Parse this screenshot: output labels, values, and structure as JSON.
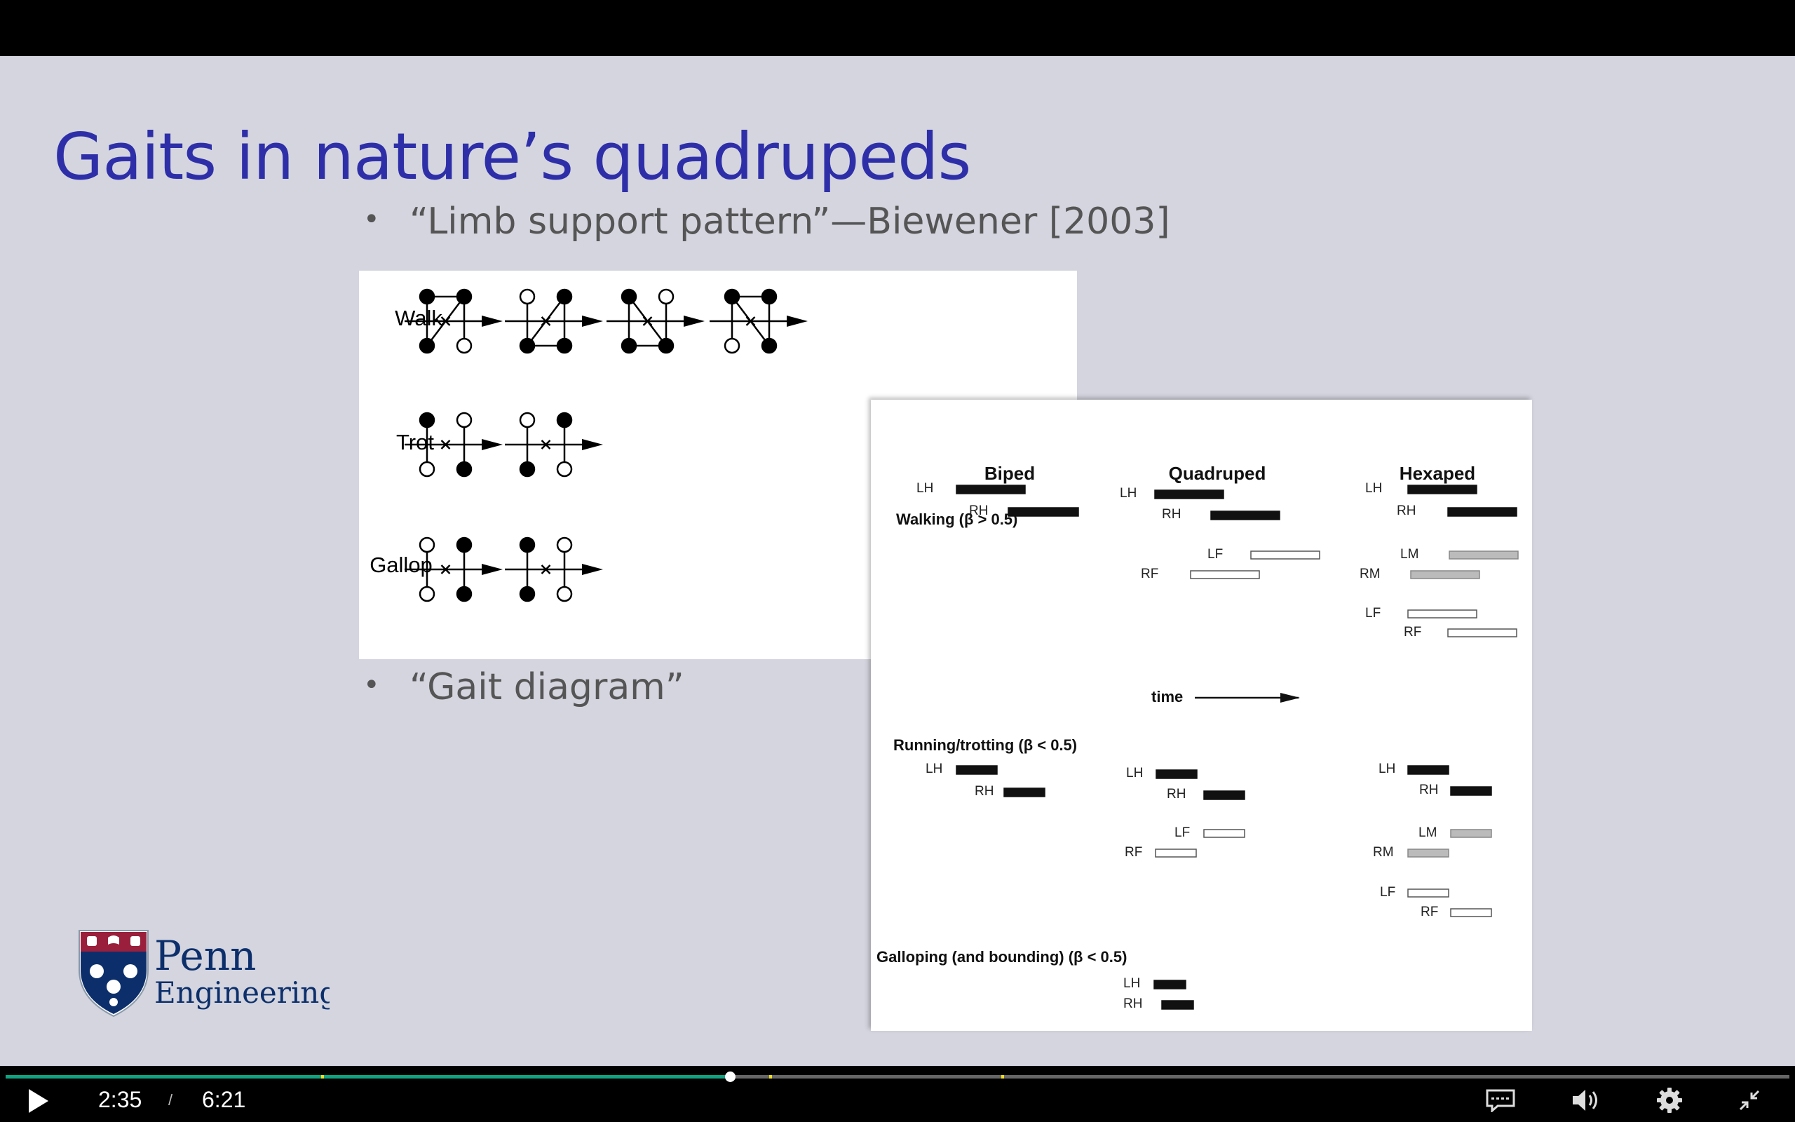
{
  "slide": {
    "title": "Gaits in nature’s quadrupeds",
    "bullets": [
      "“Limb support pattern”—Biewener [2003]",
      "“Gait diagram”"
    ]
  },
  "support_figure": {
    "rows": [
      "Walk",
      "Trot",
      "Gallop"
    ]
  },
  "gait_figure": {
    "headers": [
      "Biped",
      "Quadruped",
      "Hexaped"
    ],
    "sections": [
      "Walking (β > 0.5)",
      "Running/trotting (β < 0.5)",
      "Galloping (and bounding)  (β < 0.5)"
    ],
    "time_label": "time",
    "limb_labels": {
      "lh": "LH",
      "rh": "RH",
      "lf": "LF",
      "rf": "RF",
      "lm": "LM",
      "rm": "RM"
    }
  },
  "logo": {
    "line1": "Penn",
    "line2": "Engineering"
  },
  "player": {
    "current_time": "2:35",
    "separator": "/",
    "duration": "6:21",
    "progress": 0.406,
    "chapter_markers": [
      0.177,
      0.428,
      0.558
    ],
    "colors": {
      "progress": "#10a37f",
      "marker": "#f0e020",
      "track": "#666666"
    }
  }
}
